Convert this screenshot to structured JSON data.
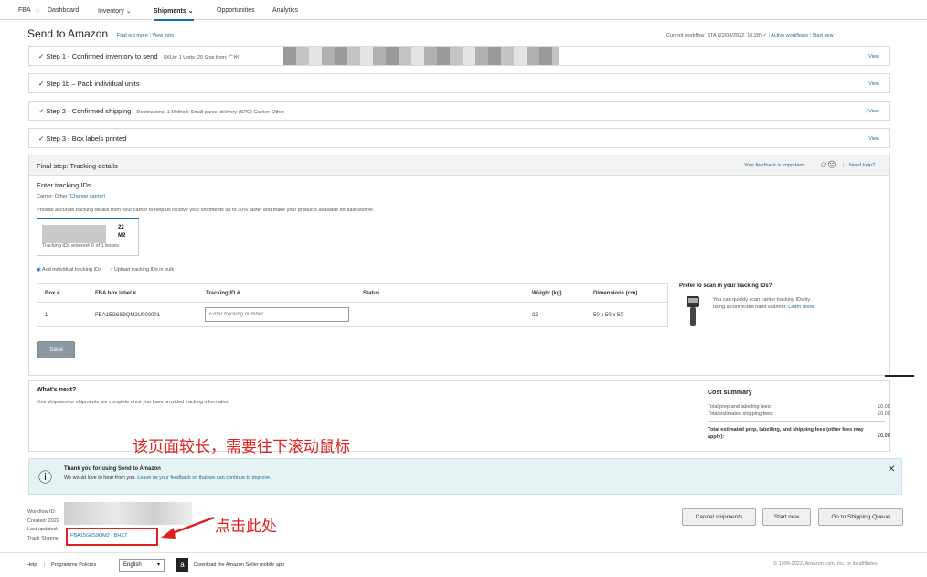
{
  "nav": {
    "fba": "FBA",
    "items": [
      "Dashboard",
      "Inventory",
      "Shipments",
      "Opportunities",
      "Analytics"
    ]
  },
  "header": {
    "title": "Send to Amazon",
    "find_out_more": "Find out more",
    "view_intro": "View intro",
    "workflow": "Current workflow: STA (22/08/2022, 16:28)",
    "active_workflows": "Active workflows",
    "start_new": "Start new"
  },
  "steps": [
    {
      "label": "Step 1 - Confirmed inventory to send",
      "meta": "SKUs: 1   Units: 20   Ship from: 广州",
      "view": "View"
    },
    {
      "label": "Step 1b – Pack individual units",
      "meta": "",
      "view": "View"
    },
    {
      "label": "Step 2 - Confirmed shipping",
      "meta": "Destinations: 1   Method: Small parcel delivery (SPD)   Carrier: Other",
      "view": "View"
    },
    {
      "label": "Step 3 - Box labels printed",
      "meta": "",
      "view": "View"
    }
  ],
  "final": {
    "title": "Final step: Tracking details",
    "feedback": "Your feedback is important",
    "need_help": "Need help?",
    "enter_tracking": "Enter tracking IDs",
    "carrier": "Carrier: Other",
    "change_carrier": "(Change carrier)",
    "provide": "Provide accurate tracking details from your carrier to help us receive your shipments up to 30% faster and make your products available for sale sooner.",
    "card_line1": "22",
    "card_line2": "M2",
    "card_line3": "Tracking IDs entered: 0 of 1 boxes",
    "radio_individual": "Add individual tracking IDs",
    "radio_bulk": "Upload tracking IDs in bulk",
    "columns": [
      "Box #",
      "FBA box label #",
      "Tracking ID #",
      "Status",
      "Weight (kg)",
      "Dimensions (cm)"
    ],
    "row": {
      "box": "1",
      "label": "FBA15G6S9QM2U000001",
      "placeholder": "Enter tracking number",
      "status": "-",
      "weight": "22",
      "dims": "50 x 50 x 50"
    },
    "save": "Save",
    "scan_title": "Prefer to scan in your tracking IDs?",
    "scan_text": "You can quickly scan carrier tracking IDs by using a connected hand scanner.",
    "learn_more": "Learn more"
  },
  "next": {
    "title": "What's next?",
    "text": "Your shipment or shipments are complete once you have provided tracking information"
  },
  "cost": {
    "title": "Cost summary",
    "rows": [
      {
        "label": "Total prep and labelling fees:",
        "value": "£0.00"
      },
      {
        "label": "Total estimated shipping fees:",
        "value": "£0.00"
      },
      {
        "label": "Total estimated prep, labelling, and shipping fees (other fees may apply):",
        "value": "£0.00"
      }
    ]
  },
  "banner": {
    "title": "Thank you for using Send to Amazon",
    "text": "We would love to hear from you.",
    "link": "Leave us your feedback so that we can continue to improve."
  },
  "meta": {
    "workflow_id": "Workflow ID:",
    "created": "Created: 2022",
    "updated": "Last updated:",
    "track": "Track Shipme",
    "track_link": "FBA15G6S9QM2 - BHX7"
  },
  "buttons": {
    "cancel": "Cancel shipments",
    "start_new": "Start new",
    "queue": "Go to Shipping Queue"
  },
  "footer": {
    "help": "Help",
    "policies": "Programme Policies",
    "language": "English",
    "app": "Download the Amazon Seller mobile app",
    "copyright": "© 1999-2022, Amazon.com, Inc. or its affiliates"
  },
  "annotations": {
    "scroll": "该页面较长，需要往下滚动鼠标",
    "click": "点击此处"
  },
  "colors": {
    "accent": "#146eb4",
    "link": "#1a6a9c",
    "annotation": "#e02020",
    "banner_bg": "#e6f3f4"
  }
}
